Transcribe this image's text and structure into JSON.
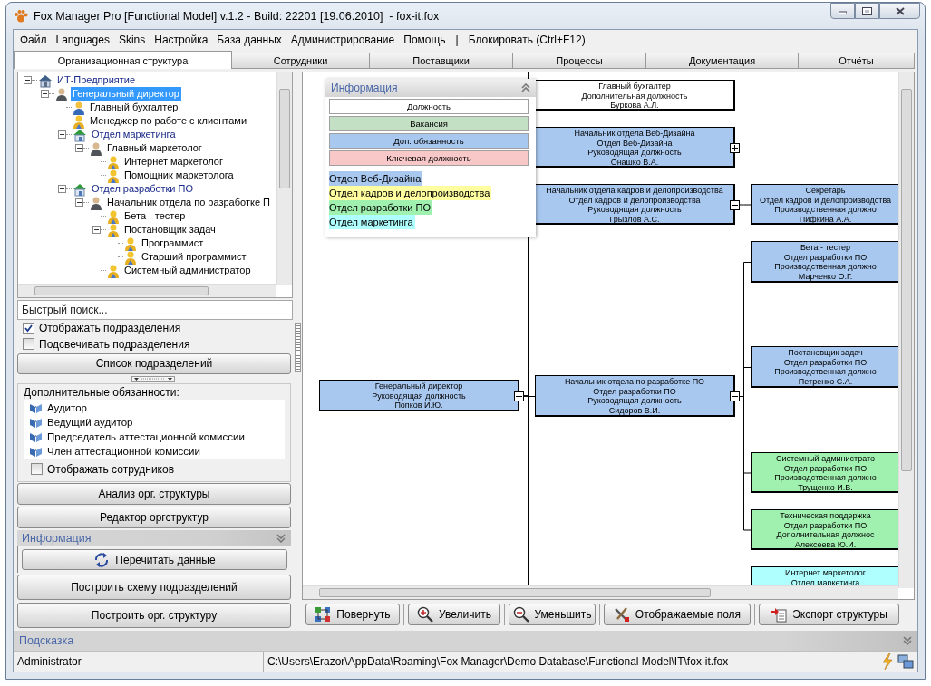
{
  "window": {
    "title": "Fox Manager Pro [Functional Model] v.1.2 - Build: 22201 [19.06.2010]  - fox-it.fox"
  },
  "menu": [
    {
      "label": "Файл",
      "kind": "item"
    },
    {
      "label": "Languages",
      "kind": "item"
    },
    {
      "label": "Skins",
      "kind": "item"
    },
    {
      "label": "Настройка",
      "kind": "item"
    },
    {
      "label": "База данных",
      "kind": "item"
    },
    {
      "label": "Администрирование",
      "kind": "item"
    },
    {
      "label": "Помощь",
      "kind": "item"
    },
    {
      "label": "|",
      "kind": "separator"
    },
    {
      "label": "Блокировать (Ctrl+F12)",
      "kind": "item"
    }
  ],
  "tabs": [
    {
      "label": "Организационная структура",
      "selected": true
    },
    {
      "label": "Сотрудники",
      "selected": false
    },
    {
      "label": "Поставщики",
      "selected": false
    },
    {
      "label": "Процессы",
      "selected": false
    },
    {
      "label": "Документация",
      "selected": false
    },
    {
      "label": "Отчёты",
      "selected": false
    }
  ],
  "tree": {
    "items": [
      {
        "label": "ИТ-Предприятие",
        "kind": "company",
        "selected": false,
        "expanded": true,
        "children": [
          {
            "label": "Генеральный директор",
            "kind": "manager",
            "selected": true,
            "expanded": true,
            "children": [
              {
                "label": "Главный бухгалтер",
                "kind": "officer",
                "selected": false
              },
              {
                "label": "Менеджер по работе с клиентами",
                "kind": "employee",
                "selected": false
              },
              {
                "label": "Отдел маркетинга",
                "kind": "department",
                "selected": false,
                "expanded": true,
                "children": [
                  {
                    "label": "Главный маркетолог",
                    "kind": "manager",
                    "selected": false,
                    "expanded": true,
                    "children": [
                      {
                        "label": "Интернет маркетолог",
                        "kind": "employee",
                        "selected": false
                      },
                      {
                        "label": "Помощник маркетолога",
                        "kind": "employee",
                        "selected": false
                      }
                    ]
                  }
                ]
              },
              {
                "label": "Отдел разработки ПО",
                "kind": "department",
                "selected": false,
                "expanded": true,
                "children": [
                  {
                    "label": "Начальник отдела по разработке П",
                    "kind": "manager",
                    "selected": false,
                    "expanded": true,
                    "children": [
                      {
                        "label": "Бета - тестер",
                        "kind": "employee",
                        "selected": false
                      },
                      {
                        "label": "Постановщик задач",
                        "kind": "employee",
                        "selected": false,
                        "expanded": true,
                        "children": [
                          {
                            "label": "Программист",
                            "kind": "employee",
                            "selected": false
                          },
                          {
                            "label": "Старший программист",
                            "kind": "employee",
                            "selected": false
                          }
                        ]
                      },
                      {
                        "label": "Системный администратор",
                        "kind": "employee",
                        "selected": false
                      }
                    ]
                  }
                ]
              }
            ]
          }
        ]
      }
    ]
  },
  "quick_search": {
    "placeholder": "Быстрый поиск..."
  },
  "options": [
    {
      "label": "Отображать подразделения",
      "checked": true
    },
    {
      "label": "Подсвечивать подразделения",
      "checked": false
    }
  ],
  "departments_button": "Список подразделений",
  "extra_duties": {
    "title": "Дополнительные обязанности:",
    "items": [
      "Аудитор",
      "Ведущий аудитор",
      "Председатель аттестационной комиссии",
      "Член аттестационной комиссии"
    ],
    "show_employees": {
      "label": "Отображать сотрудников",
      "checked": false
    }
  },
  "analysis_buttons": [
    "Анализ орг. структуры",
    "Редактор оргструктур"
  ],
  "info_section": {
    "title": "Информация",
    "buttons": [
      {
        "label": "Перечитать данные",
        "kind": "refresh"
      },
      {
        "label": "Построить схему подразделений",
        "kind": "plain"
      },
      {
        "label": "Построить орг. структуру",
        "kind": "plain"
      }
    ]
  },
  "legend": {
    "title": "Информация",
    "position_types": [
      {
        "label": "Должность",
        "color": "#ffffff"
      },
      {
        "label": "Вакансия",
        "color": "#c4e0c4"
      },
      {
        "label": "Доп. обязанность",
        "color": "#a8c8f0"
      },
      {
        "label": "Ключевая должность",
        "color": "#f8c8c8"
      }
    ],
    "departments": [
      {
        "label": "Отдел Веб-Дизайна",
        "color": "#a8c8f0"
      },
      {
        "label": "Отдел кадров и делопроизводства",
        "color": "#ffffa0"
      },
      {
        "label": "Отдел разработки ПО",
        "color": "#a0f0b0"
      },
      {
        "label": "Отдел маркетинга",
        "color": "#b0ffff"
      }
    ]
  },
  "org_chart": {
    "nodes": [
      {
        "lines": [
          "Генеральный директор",
          "Руководящая должность",
          "Попков И.Ю."
        ],
        "color": "#a8c8f0",
        "expanded": true,
        "children": [
          {
            "lines": [
              "Главный бухгалтер",
              "Дополнительная должность",
              "Буркова А.Л."
            ],
            "color": "#ffffff"
          },
          {
            "lines": [
              "Начальник отдела Веб-Дизайна",
              "Отдел Веб-Дизайна",
              "Руководящая должность",
              "Онашко В.А."
            ],
            "color": "#a8c8f0",
            "expanded": false
          },
          {
            "lines": [
              "Начальник отдела кадров и делопроизводства",
              "Отдел кадров и делопроизводства",
              "Руководящая должность",
              "Грызлов А.С."
            ],
            "color": "#a8c8f0",
            "expanded": true,
            "children": [
              {
                "lines": [
                  "Секретарь",
                  "Отдел кадров и делопроизводства",
                  "Производственная должно",
                  "Пифкина А.А."
                ],
                "color": "#a8c8f0"
              }
            ]
          },
          {
            "lines": [
              "Начальник отдела по разработке ПО",
              "Отдел разработки ПО",
              "Руководящая должность",
              "Сидоров В.И."
            ],
            "color": "#a8c8f0",
            "expanded": true,
            "children": [
              {
                "lines": [
                  "Бета - тестер",
                  "Отдел разработки ПО",
                  "Производственная должно",
                  "Марченко О.Г."
                ],
                "color": "#a8c8f0"
              },
              {
                "lines": [
                  "Постановщик задач",
                  "Отдел разработки ПО",
                  "Производственная должно",
                  "Петренко С.А."
                ],
                "color": "#a8c8f0"
              },
              {
                "lines": [
                  "Системный администрато",
                  "Отдел разработки ПО",
                  "Производственная должно",
                  "Трущенко И.В."
                ],
                "color": "#a0f0b0"
              },
              {
                "lines": [
                  "Техническая поддержка",
                  "Отдел разработки ПО",
                  "Дополнительная должнос",
                  "Алексеева Ю.И."
                ],
                "color": "#a0f0b0"
              }
            ]
          }
        ]
      },
      {
        "lines": [
          "Интернет маркетолог",
          "Отдел маркетинга"
        ],
        "color": "#b0ffff"
      }
    ]
  },
  "toolbar": [
    {
      "label": "Повернуть",
      "kind": "rotate"
    },
    {
      "label": "Увеличить",
      "kind": "zoom_in"
    },
    {
      "label": "Уменьшить",
      "kind": "zoom_out"
    },
    {
      "label": "Отображаемые поля",
      "kind": "fields"
    },
    {
      "label": "Экспорт структуры",
      "kind": "export"
    }
  ],
  "hint_bar": {
    "title": "Подсказка"
  },
  "status_bar": {
    "user": "Administrator",
    "path": "C:\\Users\\Erazor\\AppData\\Roaming\\Fox Manager\\Demo Database\\Functional Model\\IT\\fox-it.fox"
  }
}
